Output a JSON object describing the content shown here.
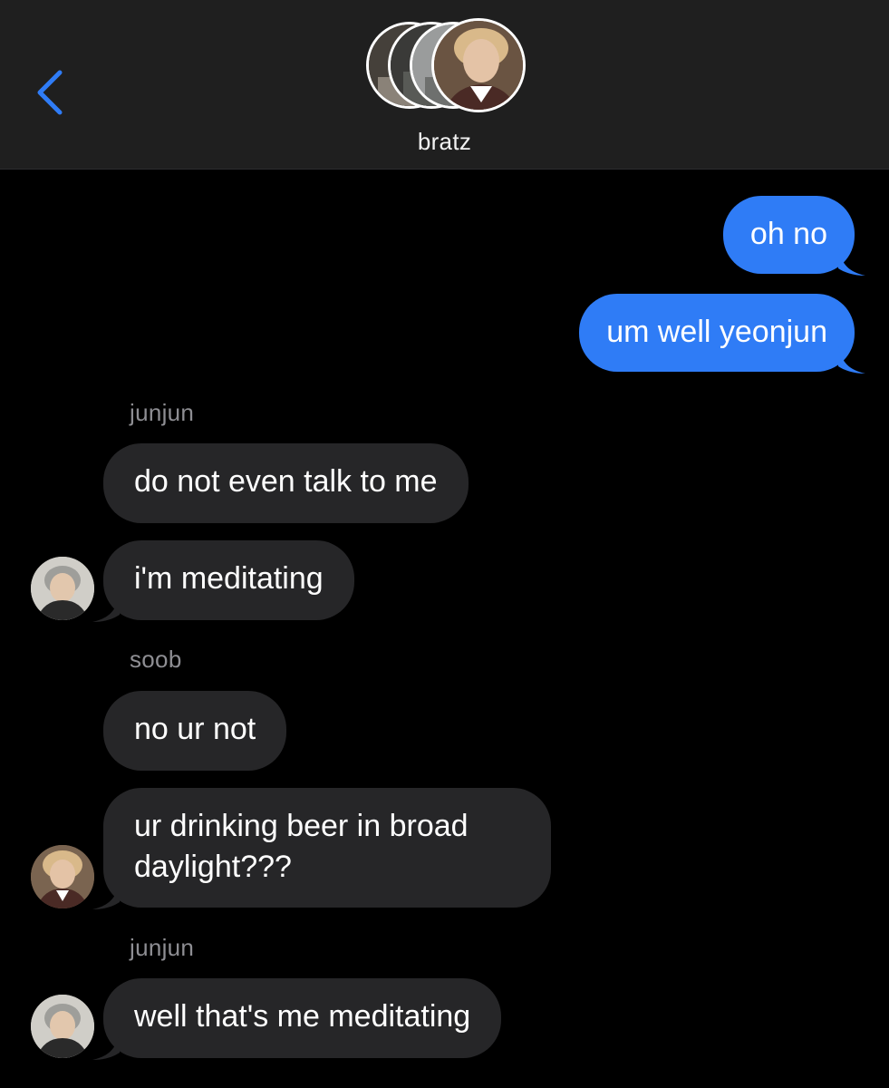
{
  "header": {
    "group_name": "bratz",
    "back_icon": "chevron-left-icon",
    "accent": "#2f7cf6"
  },
  "messages": [
    {
      "type": "sent",
      "text": "oh no"
    },
    {
      "type": "sent",
      "text": "um well yeonjun"
    },
    {
      "type": "sender_label",
      "text": "junjun"
    },
    {
      "type": "received",
      "text": "do not even talk to me"
    },
    {
      "type": "received",
      "text": "i'm meditating"
    },
    {
      "type": "sender_label",
      "text": "soob"
    },
    {
      "type": "received",
      "text": "no ur not"
    },
    {
      "type": "received",
      "line1": "ur drinking beer in broad",
      "line2": "daylight???"
    },
    {
      "type": "sender_label",
      "text": "junjun"
    },
    {
      "type": "received",
      "text": "well that's me meditating"
    }
  ],
  "colors": {
    "sent_bubble": "#2f7cf6",
    "received_bubble": "#262628",
    "background": "#000000",
    "header_background": "#1f1f1f"
  }
}
